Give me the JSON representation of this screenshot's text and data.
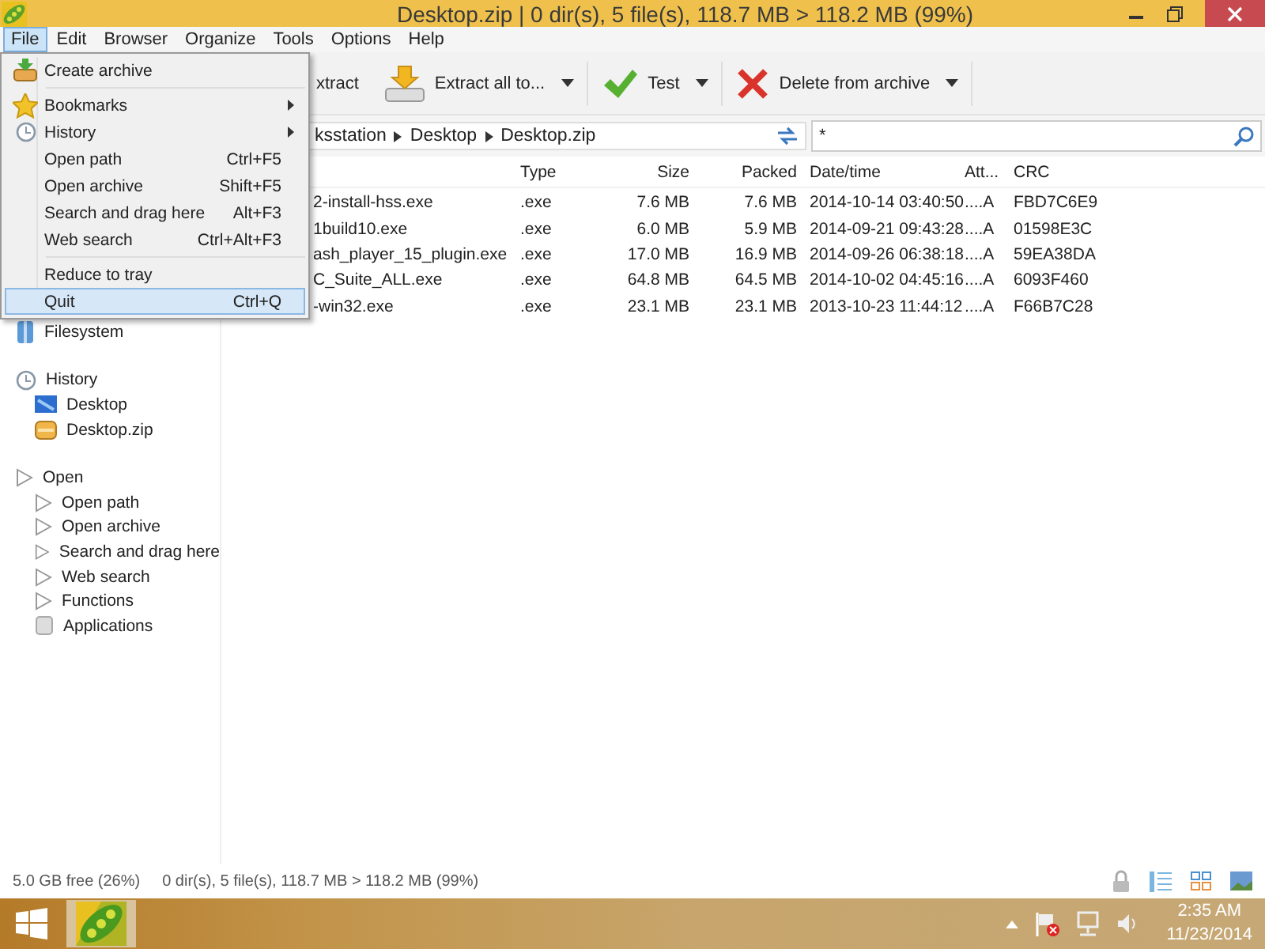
{
  "window": {
    "title": "Desktop.zip | 0 dir(s), 5 file(s), 118.7 MB > 118.2 MB (99%)"
  },
  "menubar": [
    {
      "label": "File",
      "selected": true
    },
    {
      "label": "Edit",
      "selected": false
    },
    {
      "label": "Browser",
      "selected": false
    },
    {
      "label": "Organize",
      "selected": false
    },
    {
      "label": "Tools",
      "selected": false
    },
    {
      "label": "Options",
      "selected": false
    },
    {
      "label": "Help",
      "selected": false
    }
  ],
  "file_menu": [
    [
      {
        "label": "Create archive",
        "selected": false
      }
    ],
    [
      {
        "label": "Bookmarks",
        "submenu": true,
        "selected": false
      },
      {
        "label": "History",
        "submenu": true,
        "selected": false
      },
      {
        "label": "Open path",
        "shortcut": "Ctrl+F5",
        "selected": false
      },
      {
        "label": "Open archive",
        "shortcut": "Shift+F5",
        "selected": false
      },
      {
        "label": "Search and drag here",
        "shortcut": "Alt+F3",
        "selected": false
      },
      {
        "label": "Web search",
        "shortcut": "Ctrl+Alt+F3",
        "selected": false
      }
    ],
    [
      {
        "label": "Reduce to tray",
        "selected": false
      },
      {
        "label": "Quit",
        "shortcut": "Ctrl+Q",
        "selected": true
      }
    ]
  ],
  "toolbar": [
    {
      "label": "xtract"
    },
    {
      "label": "Extract all to...",
      "dropdown": true
    },
    {
      "label": "Test",
      "dropdown": true
    },
    {
      "label": "Delete from archive",
      "dropdown": true
    }
  ],
  "address": {
    "path": [
      "ksstation",
      "Desktop",
      "Desktop.zip"
    ],
    "filter": "*"
  },
  "table": {
    "columns": [
      "Type",
      "Size",
      "Packed",
      "Date/time",
      "Att...",
      "CRC"
    ],
    "rows": [
      {
        "name": "2-install-hss.exe",
        "type": ".exe",
        "size": "7.6 MB",
        "packed": "7.6 MB",
        "date": "2014-10-14 03:40:50",
        "attr": "....A",
        "crc": "FBD7C6E9"
      },
      {
        "name": "1build10.exe",
        "type": ".exe",
        "size": "6.0 MB",
        "packed": "5.9 MB",
        "date": "2014-09-21 09:43:28",
        "attr": "....A",
        "crc": "01598E3C"
      },
      {
        "name": "ash_player_15_plugin.exe",
        "type": ".exe",
        "size": "17.0 MB",
        "packed": "16.9 MB",
        "date": "2014-09-26 06:38:18",
        "attr": "....A",
        "crc": "59EA38DA"
      },
      {
        "name": "C_Suite_ALL.exe",
        "type": ".exe",
        "size": "64.8 MB",
        "packed": "64.5 MB",
        "date": "2014-10-02 04:45:16",
        "attr": "....A",
        "crc": "6093F460"
      },
      {
        "name": "-win32.exe",
        "type": ".exe",
        "size": "23.1 MB",
        "packed": "23.1 MB",
        "date": "2013-10-23 11:44:12",
        "attr": "....A",
        "crc": "F66B7C28"
      }
    ]
  },
  "sidebar": [
    {
      "label": "Filesystem"
    },
    {
      "label": "History",
      "children": [
        {
          "label": "Desktop"
        },
        {
          "label": "Desktop.zip"
        }
      ]
    },
    {
      "label": "Open",
      "children": [
        {
          "label": "Open path"
        },
        {
          "label": "Open archive"
        },
        {
          "label": "Search and drag here"
        },
        {
          "label": "Web search"
        },
        {
          "label": "Functions"
        },
        {
          "label": "Applications"
        }
      ]
    }
  ],
  "status_bar": {
    "free": "5.0 GB free (26%)",
    "summary": "0 dir(s), 5 file(s), 118.7 MB > 118.2 MB (99%)"
  },
  "taskbar": {
    "time": "2:35 AM",
    "date": "11/23/2014"
  }
}
